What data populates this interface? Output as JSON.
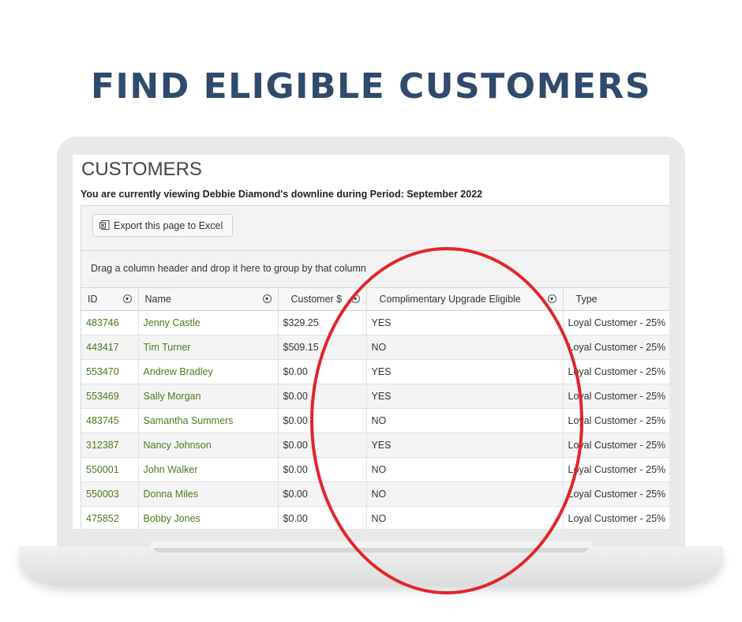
{
  "headline": "FIND ELIGIBLE CUSTOMERS",
  "page": {
    "title": "CUSTOMERS",
    "subtitle": "You are currently viewing Debbie Diamond's downline during Period: September 2022"
  },
  "toolbar": {
    "export_label": "Export this page to Excel"
  },
  "group_panel": {
    "hint": "Drag a column header and drop it here to group by that column"
  },
  "table": {
    "columns": [
      "ID",
      "Name",
      "Customer $",
      "Complimentary Upgrade Eligible",
      "Type"
    ],
    "rows": [
      [
        "483746",
        "Jenny Castle",
        "$329.25",
        "YES",
        "Loyal Customer - 25%"
      ],
      [
        "443417",
        "Tim Turner",
        "$509.15",
        "NO",
        "Loyal Customer - 25%"
      ],
      [
        "553470",
        "Andrew Bradley",
        "$0.00",
        "YES",
        "Loyal Customer - 25%"
      ],
      [
        "553469",
        "Sally Morgan",
        "$0.00",
        "YES",
        "Loyal Customer - 25%"
      ],
      [
        "483745",
        "Samantha Summers",
        "$0.00",
        "NO",
        "Loyal Customer - 25%"
      ],
      [
        "312387",
        "Nancy Johnson",
        "$0.00",
        "YES",
        "Loyal Customer - 25%"
      ],
      [
        "550001",
        "John Walker",
        "$0.00",
        "NO",
        "Loyal Customer - 25%"
      ],
      [
        "550003",
        "Donna Miles",
        "$0.00",
        "NO",
        "Loyal Customer - 25%"
      ],
      [
        "475852",
        "Bobby Jones",
        "$0.00",
        "NO",
        "Loyal Customer - 25%"
      ]
    ]
  },
  "colors": {
    "headline": "#2f4a6b",
    "link": "#4b7a1e",
    "annotation": "#e0262b"
  },
  "icons": {
    "export": "excel-export-icon",
    "filter": "filter-icon"
  }
}
